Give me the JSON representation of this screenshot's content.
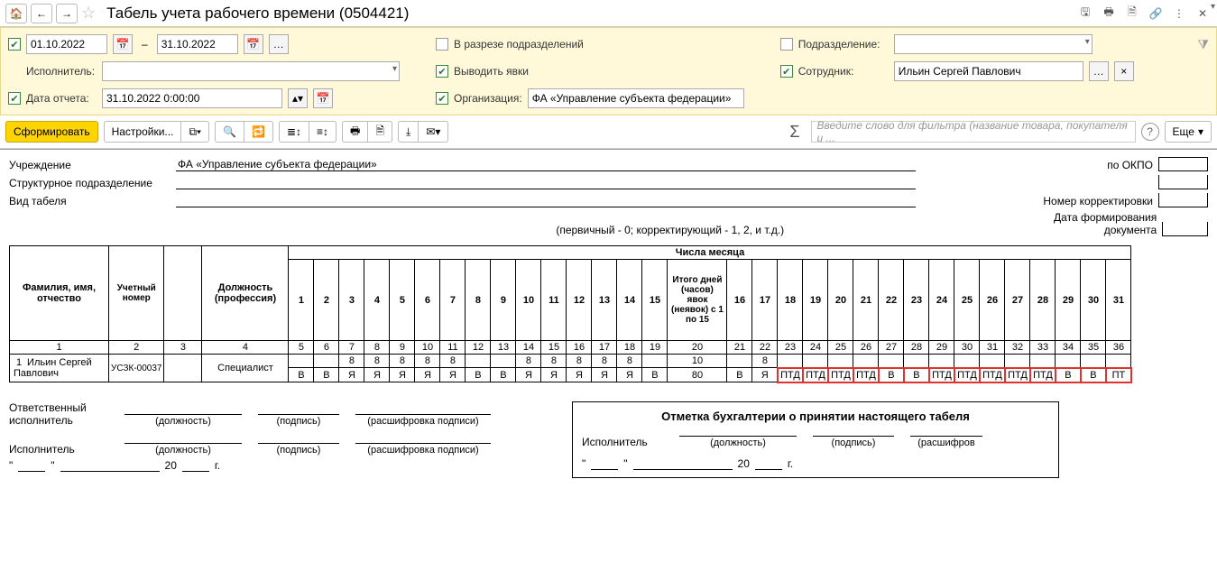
{
  "titlebar": {
    "title": "Табель учета рабочего времени (0504421)"
  },
  "filters": {
    "date_from": "01.10.2022",
    "date_to": "31.10.2022",
    "executor_label": "Исполнитель:",
    "report_date_label": "Дата отчета:",
    "report_date": "31.10.2022  0:00:00",
    "by_dept_label": "В разрезе подразделений",
    "show_attendance_label": "Выводить явки",
    "org_label": "Организация:",
    "org_value": "ФА «Управление субъекта федерации»",
    "dept_label": "Подразделение:",
    "employee_label": "Сотрудник:",
    "employee_value": "Ильин Сергей Павлович"
  },
  "toolbar": {
    "generate": "Сформировать",
    "settings": "Настройки...",
    "more": "Еще",
    "filter_placeholder": "Введите слово для фильтра (название товара, покупателя и ..."
  },
  "report_header": {
    "institution_label": "Учреждение",
    "institution_value": "ФА «Управление субъекта федерации»",
    "structural_label": "Структурное подразделение",
    "tabel_type_label": "Вид табеля",
    "tabel_note": "(первичный - 0; корректирующий - 1, 2, и т.д.)",
    "okpo_label": "по ОКПО",
    "corr_label": "Номер корректировки",
    "doc_date_label": "Дата формирования документа"
  },
  "table": {
    "col_fio": "Фамилия, имя, отчество",
    "col_uch": "Учетный номер",
    "col_pos": "Должность (профессия)",
    "col_month_days": "Числа месяца",
    "col_total_1_15": "Итого дней (часов) явок (неявок) с 1 по 15",
    "days_1_15": [
      "1",
      "2",
      "3",
      "4",
      "5",
      "6",
      "7",
      "8",
      "9",
      "10",
      "11",
      "12",
      "13",
      "14",
      "15"
    ],
    "days_16_31": [
      "16",
      "17",
      "18",
      "19",
      "20",
      "21",
      "22",
      "23",
      "24",
      "25",
      "26",
      "27",
      "28",
      "29",
      "30",
      "31"
    ],
    "num_cols_row": [
      "1",
      "2",
      "3",
      "4",
      "5",
      "6",
      "7",
      "8",
      "9",
      "10",
      "11",
      "12",
      "13",
      "14",
      "15",
      "16",
      "17",
      "18",
      "19",
      "20",
      "21",
      "22",
      "23",
      "24",
      "25",
      "26",
      "27",
      "28",
      "29",
      "30",
      "31",
      "32",
      "33",
      "34",
      "35",
      "36"
    ],
    "row": {
      "n": "1",
      "fio": "Ильин Сергей Павлович",
      "uch": "УСЗК-00037",
      "pos": "Специалист",
      "hours_1_15": [
        "",
        "",
        "8",
        "8",
        "8",
        "8",
        "8",
        "",
        "",
        "8",
        "8",
        "8",
        "8",
        "8",
        ""
      ],
      "marks_1_15": [
        "В",
        "В",
        "Я",
        "Я",
        "Я",
        "Я",
        "Я",
        "В",
        "В",
        "Я",
        "Я",
        "Я",
        "Я",
        "Я",
        "В"
      ],
      "total_hours_1_15": "10",
      "total_marks_1_15": "80",
      "hours_16_31": [
        "",
        "8",
        "",
        "",
        "",
        "",
        "",
        "",
        "",
        "",
        "",
        "",
        "",
        "",
        "",
        ""
      ],
      "marks_16_31": [
        "В",
        "Я",
        "ПТД",
        "ПТД",
        "ПТД",
        "ПТД",
        "В",
        "В",
        "ПТД",
        "ПТД",
        "ПТД",
        "ПТД",
        "ПТД",
        "В",
        "В",
        "ПТ"
      ]
    }
  },
  "signatures": {
    "resp_exec_label": "Ответственный исполнитель",
    "exec_label": "Исполнитель",
    "pos": "(должность)",
    "sign": "(подпись)",
    "decode": "(расшифровка подписи)",
    "year20": "20",
    "year_suffix": "г.",
    "accounting_title": "Отметка бухгалтерии о принятии настоящего табеля",
    "accounting_exec": "Исполнитель",
    "decode_short": "(расшифров"
  }
}
